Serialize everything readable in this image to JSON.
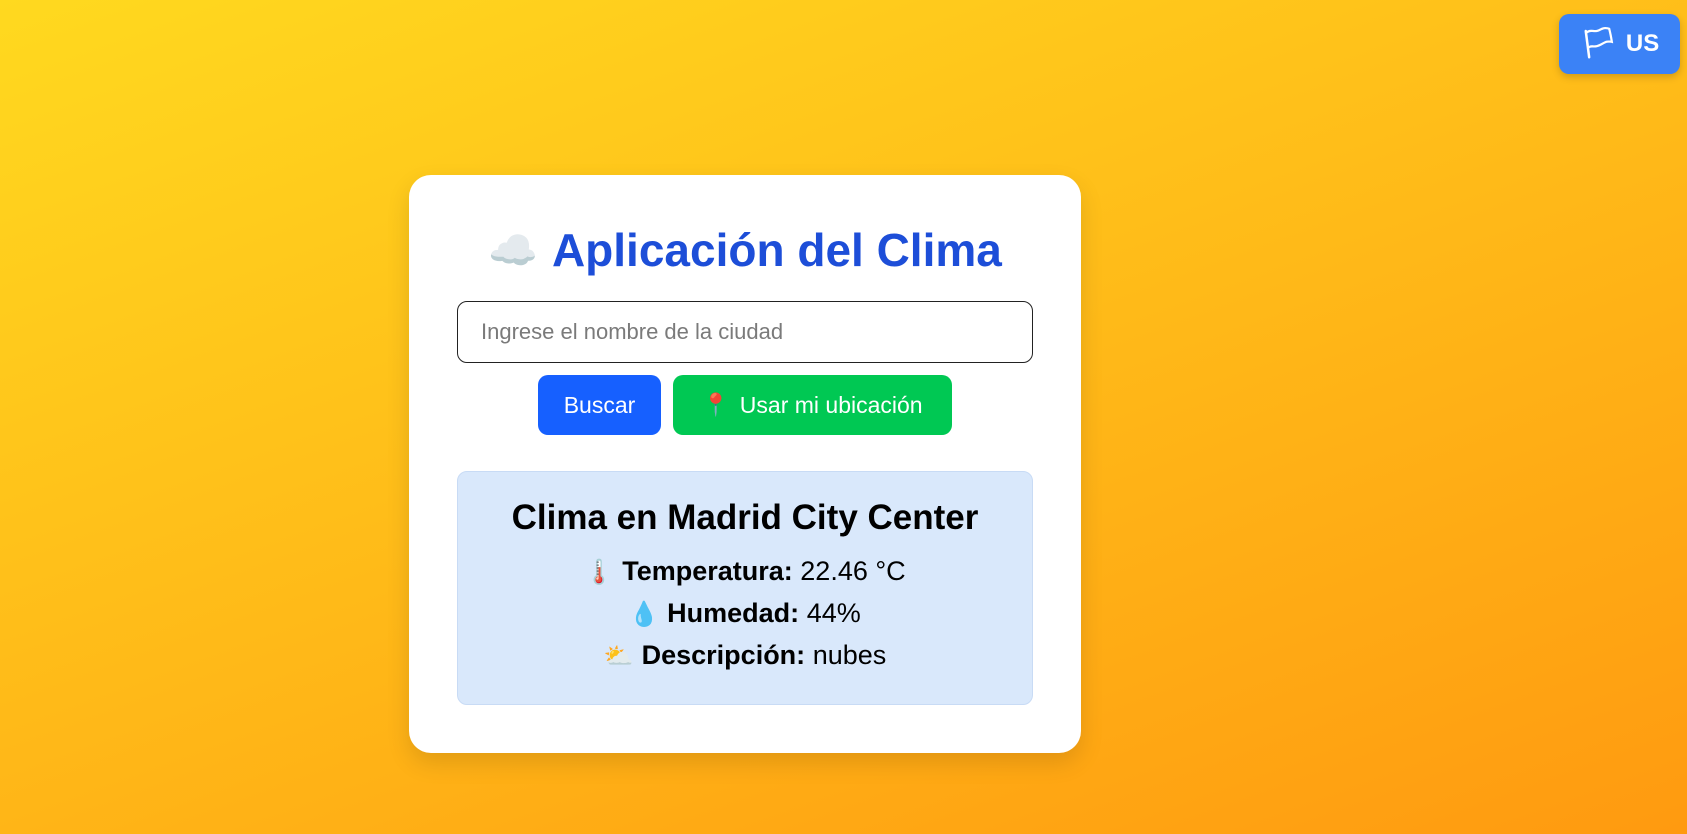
{
  "language_button": {
    "icon": "flag-icon",
    "label": "US"
  },
  "app": {
    "title_icon": "cloud-icon",
    "title": "Aplicación del Clima"
  },
  "search": {
    "placeholder": "Ingrese el nombre de la ciudad",
    "value": "",
    "search_button": "Buscar",
    "location_icon": "pin-icon",
    "location_button": "Usar mi ubicación"
  },
  "weather": {
    "title": "Clima en Madrid City Center",
    "temperature": {
      "icon": "thermometer-icon",
      "label": "Temperatura:",
      "value": "22.46 °C"
    },
    "humidity": {
      "icon": "droplet-icon",
      "label": "Humedad:",
      "value": "44%"
    },
    "description": {
      "icon": "sun-behind-cloud-icon",
      "label": "Descripción:",
      "value": "nubes"
    }
  },
  "colors": {
    "title": "#1d4ed8",
    "search_button": "#1660ff",
    "location_button": "#00c853",
    "language_button": "#3b82f6",
    "weather_box": "#d9e8fb"
  }
}
